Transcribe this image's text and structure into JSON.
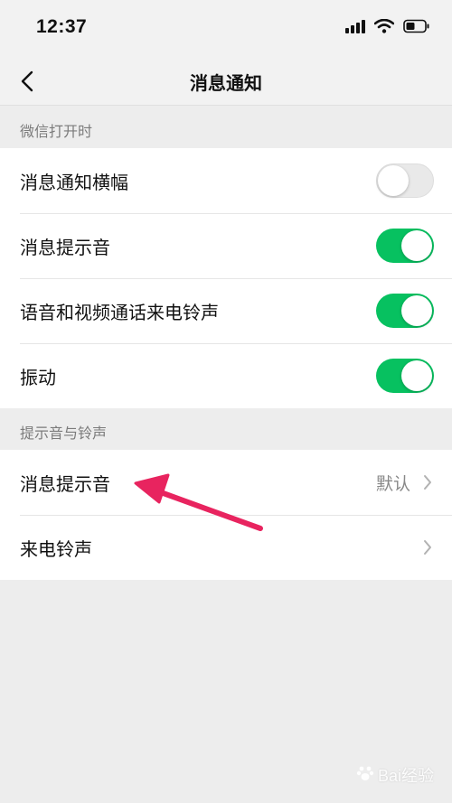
{
  "status_bar": {
    "time": "12:37"
  },
  "nav": {
    "title": "消息通知"
  },
  "sections": [
    {
      "header": "微信打开时",
      "rows": [
        {
          "label": "消息通知横幅",
          "toggle": "off"
        },
        {
          "label": "消息提示音",
          "toggle": "on"
        },
        {
          "label": "语音和视频通话来电铃声",
          "toggle": "on"
        },
        {
          "label": "振动",
          "toggle": "on"
        }
      ]
    },
    {
      "header": "提示音与铃声",
      "rows": [
        {
          "label": "消息提示音",
          "value": "默认"
        },
        {
          "label": "来电铃声",
          "value": ""
        }
      ]
    }
  ],
  "colors": {
    "accent": "#07c160",
    "annotation_arrow": "#e8245f",
    "background": "#ededed"
  },
  "watermark": {
    "text": "Bai经验"
  }
}
